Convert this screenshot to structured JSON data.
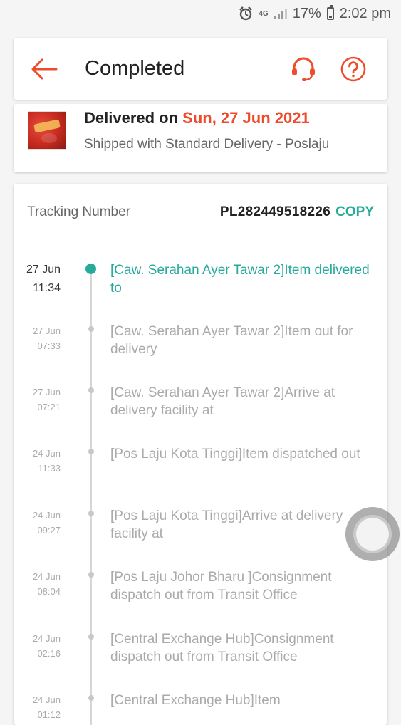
{
  "status_bar": {
    "network": "4G",
    "battery": "17%",
    "time": "2:02 pm"
  },
  "header": {
    "title": "Completed",
    "back_icon": "arrow-left-icon",
    "support_icon": "headset-icon",
    "help_icon": "question-circle-icon"
  },
  "summary": {
    "delivered_prefix": "Delivered on ",
    "delivered_date": "Sun, 27 Jun 2021",
    "shipping": "Shipped with Standard Delivery  - Poslaju"
  },
  "tracking": {
    "label": "Tracking Number",
    "number": "PL282449518226",
    "copy_label": "COPY",
    "events": [
      {
        "date": "27 Jun",
        "time": "11:34",
        "text": "[Caw. Serahan Ayer Tawar 2]Item delivered to"
      },
      {
        "date": "27 Jun",
        "time": "07:33",
        "text": "[Caw. Serahan Ayer Tawar 2]Item out for delivery"
      },
      {
        "date": "27 Jun",
        "time": "07:21",
        "text": "[Caw. Serahan Ayer Tawar 2]Arrive at delivery facility at"
      },
      {
        "date": "24 Jun",
        "time": "11:33",
        "text": "[Pos Laju Kota Tinggi]Item dispatched out"
      },
      {
        "date": "24 Jun",
        "time": "09:27",
        "text": "[Pos Laju Kota Tinggi]Arrive at delivery facility at"
      },
      {
        "date": "24 Jun",
        "time": "08:04",
        "text": "[Pos Laju Johor Bharu ]Consignment dispatch out from Transit Office"
      },
      {
        "date": "24 Jun",
        "time": "02:16",
        "text": "[Central Exchange Hub]Consignment dispatch out from Transit Office"
      },
      {
        "date": "24 Jun",
        "time": "01:12",
        "text": "[Central Exchange Hub]Item"
      }
    ]
  },
  "colors": {
    "accent": "#ee4d2d",
    "teal": "#26aa99"
  }
}
